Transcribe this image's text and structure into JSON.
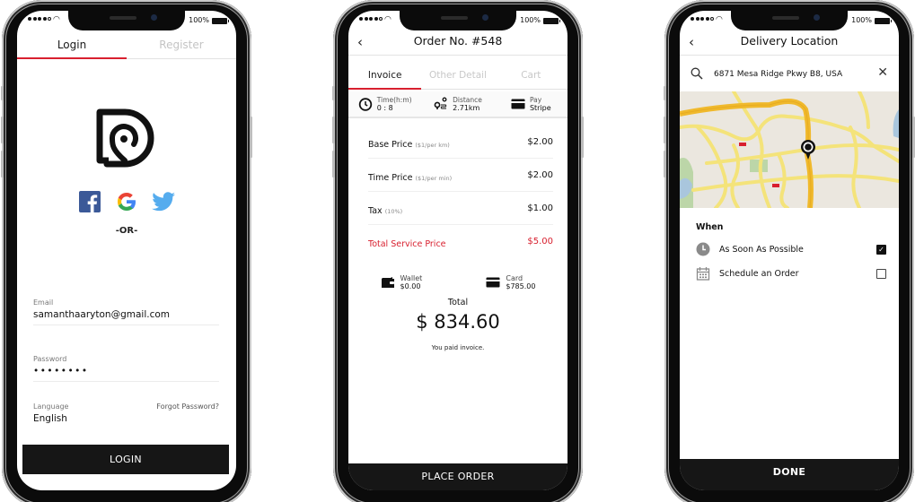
{
  "status_bar": {
    "battery": "100%"
  },
  "login_screen": {
    "tabs": [
      {
        "label": "Login",
        "active": true
      },
      {
        "label": "Register",
        "active": false
      }
    ],
    "social_icons": [
      "facebook-icon",
      "google-icon",
      "twitter-icon"
    ],
    "or_label": "-OR-",
    "email": {
      "label": "Email",
      "value": "samanthaaryton@gmail.com"
    },
    "password": {
      "label": "Password",
      "value": "••••••••"
    },
    "language": {
      "label": "Language",
      "value": "English"
    },
    "forgot_password": "Forgot Password?",
    "login_button": "LOGIN",
    "accent_color": "#d8202f"
  },
  "order_screen": {
    "title": "Order No. #548",
    "tabs": [
      {
        "label": "Invoice",
        "active": true
      },
      {
        "label": "Other Detail",
        "active": false
      },
      {
        "label": "Cart",
        "active": false
      }
    ],
    "info": [
      {
        "icon": "clock-icon",
        "title": "Time(h:m)",
        "value": "0 : 8"
      },
      {
        "icon": "route-icon",
        "title": "Distance",
        "value": "2.71km"
      },
      {
        "icon": "card-icon",
        "title": "Pay",
        "value": "Stripe"
      }
    ],
    "prices": [
      {
        "name": "Base Price",
        "note": "($1/per km)",
        "amount": "$2.00"
      },
      {
        "name": "Time Price",
        "note": "($1/per min)",
        "amount": "$2.00"
      },
      {
        "name": "Tax",
        "note": "(10%)",
        "amount": "$1.00"
      },
      {
        "name": "Total Service Price",
        "note": "",
        "amount": "$5.00",
        "highlight": true
      }
    ],
    "payments": [
      {
        "icon": "wallet-icon",
        "label": "Wallet",
        "value": "$0.00"
      },
      {
        "icon": "card-icon",
        "label": "Card",
        "value": "$785.00"
      }
    ],
    "total_label": "Total",
    "total_amount": "$ 834.60",
    "paid_note": "You paid invoice.",
    "place_order_button": "PLACE ORDER"
  },
  "delivery_screen": {
    "title": "Delivery Location",
    "search_value": "6871 Mesa Ridge Pkwy B8, USA",
    "when_label": "When",
    "options": [
      {
        "icon": "clock-icon",
        "label": "As Soon As Possible",
        "checked": true
      },
      {
        "icon": "calendar-icon",
        "label": "Schedule an Order",
        "checked": false
      }
    ],
    "done_button": "DONE"
  }
}
